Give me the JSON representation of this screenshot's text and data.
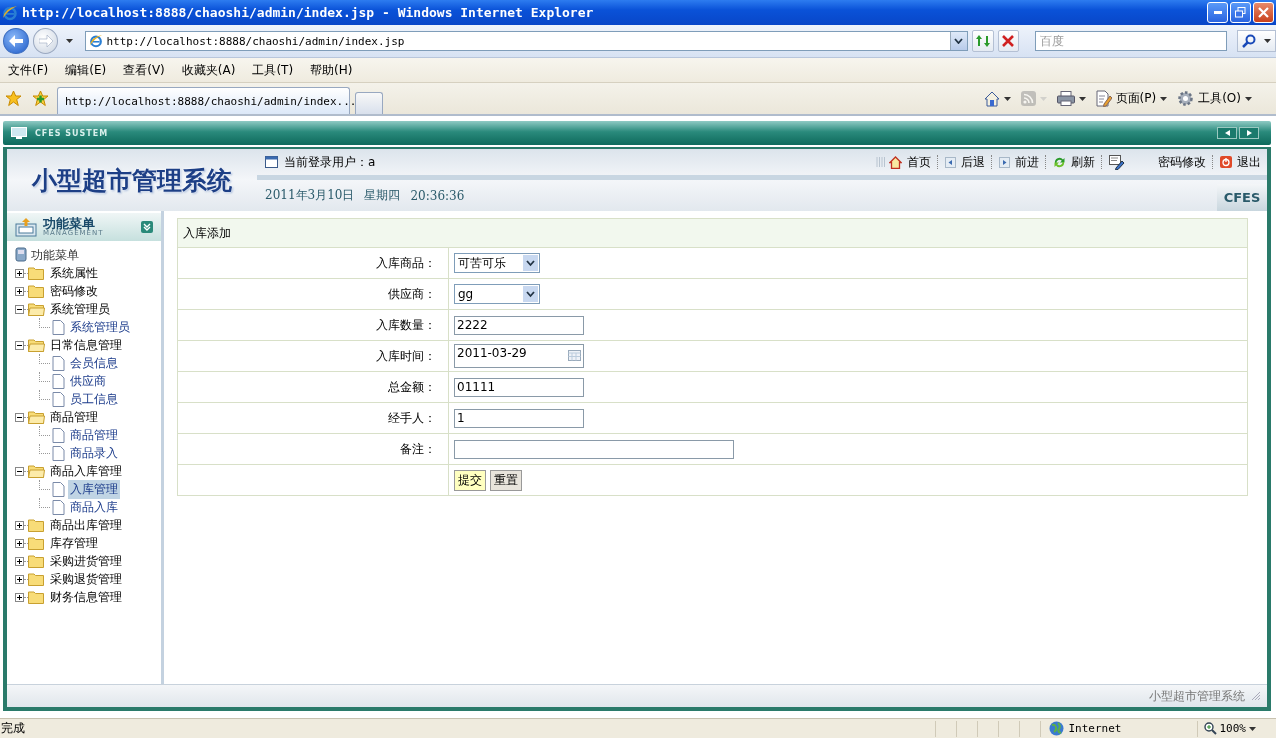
{
  "window": {
    "title": "http://localhost:8888/chaoshi/admin/index.jsp - Windows Internet Explorer"
  },
  "address_bar": {
    "url": "http://localhost:8888/chaoshi/admin/index.jsp"
  },
  "search_box": {
    "placeholder": "百度"
  },
  "menu_bar": [
    "文件(F)",
    "编辑(E)",
    "查看(V)",
    "收藏夹(A)",
    "工具(T)",
    "帮助(H)"
  ],
  "tabs": [
    {
      "label": "http://localhost:8888/chaoshi/admin/index...",
      "selected": true
    }
  ],
  "command_bar": [
    {
      "kind": "home",
      "disabled": false
    },
    {
      "kind": "feeds",
      "disabled": true
    },
    {
      "kind": "print",
      "disabled": false
    },
    {
      "kind": "page",
      "label": "页面(P)",
      "disabled": false
    },
    {
      "kind": "tools",
      "label": "工具(O)",
      "disabled": false
    }
  ],
  "page": {
    "banner": "CFES SUSTEM",
    "app_title": "小型超市管理系统",
    "current_user": "当前登录用户：a",
    "date": "2011年3月10日",
    "weekday": "星期四",
    "time": "20:36:36",
    "badge": "CFES",
    "nav_links": [
      {
        "kind": "home",
        "label": "首页"
      },
      {
        "kind": "back",
        "label": "后退"
      },
      {
        "kind": "forward",
        "label": "前进"
      },
      {
        "kind": "refresh",
        "label": "刷新"
      },
      {
        "kind": "password",
        "label": "密码修改"
      },
      {
        "kind": "logout",
        "label": "退出"
      }
    ],
    "footer": "小型超市管理系统"
  },
  "sidebar": {
    "title": "功能菜单",
    "subtitle": "MANAGEMENT",
    "tree": {
      "label": "功能菜单",
      "children": [
        {
          "label": "系统属性",
          "expanded": false,
          "selected": false
        },
        {
          "label": "密码修改",
          "expanded": false,
          "selected": false
        },
        {
          "label": "系统管理员",
          "expanded": true,
          "selected": false,
          "children": [
            {
              "label": "系统管理员",
              "selected": false
            }
          ]
        },
        {
          "label": "日常信息管理",
          "expanded": true,
          "selected": false,
          "children": [
            {
              "label": "会员信息",
              "selected": false
            },
            {
              "label": "供应商",
              "selected": false
            },
            {
              "label": "员工信息",
              "selected": false
            }
          ]
        },
        {
          "label": "商品管理",
          "expanded": true,
          "selected": false,
          "children": [
            {
              "label": "商品管理",
              "selected": false
            },
            {
              "label": "商品录入",
              "selected": false
            }
          ]
        },
        {
          "label": "商品入库管理",
          "expanded": true,
          "selected": false,
          "children": [
            {
              "label": "入库管理",
              "selected": true
            },
            {
              "label": "商品入库",
              "selected": false
            }
          ]
        },
        {
          "label": "商品出库管理",
          "expanded": false,
          "selected": false
        },
        {
          "label": "库存管理",
          "expanded": false,
          "selected": false
        },
        {
          "label": "采购进货管理",
          "expanded": false,
          "selected": false
        },
        {
          "label": "采购退货管理",
          "expanded": false,
          "selected": false
        },
        {
          "label": "财务信息管理",
          "expanded": false,
          "selected": false
        }
      ]
    }
  },
  "form": {
    "title": "入库添加",
    "fields": [
      {
        "label": "入库商品：",
        "kind": "select",
        "value": "可苦可乐"
      },
      {
        "label": "供应商：",
        "kind": "select",
        "value": "gg"
      },
      {
        "label": "入库数量：",
        "kind": "text",
        "value": "2222"
      },
      {
        "label": "入库时间：",
        "kind": "date",
        "value": "2011-03-29"
      },
      {
        "label": "总金额：",
        "kind": "text",
        "value": "01111"
      },
      {
        "label": "经手人：",
        "kind": "text",
        "value": "1"
      },
      {
        "label": "备注：",
        "kind": "wide"
      }
    ],
    "buttons": [
      {
        "label": "提交",
        "highlighted": true
      },
      {
        "label": "重置",
        "highlighted": false
      }
    ]
  },
  "status_bar": {
    "text": "完成",
    "zone": "Internet",
    "zoom": "100%"
  }
}
